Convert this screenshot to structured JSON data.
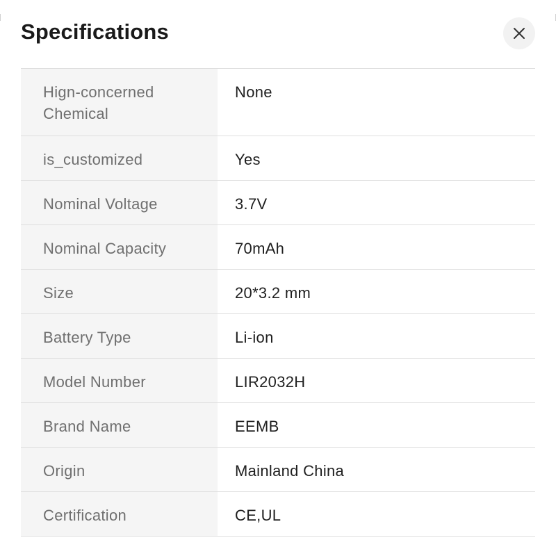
{
  "dialog": {
    "title": "Specifications"
  },
  "close_icon": "close-icon",
  "specs": [
    {
      "label": "Hign-concerned Chemical",
      "value": "None"
    },
    {
      "label": "is_customized",
      "value": "Yes"
    },
    {
      "label": "Nominal Voltage",
      "value": "3.7V"
    },
    {
      "label": "Nominal Capacity",
      "value": "70mAh"
    },
    {
      "label": "Size",
      "value": "20*3.2 mm"
    },
    {
      "label": "Battery Type",
      "value": "Li-ion"
    },
    {
      "label": "Model Number",
      "value": "LIR2032H"
    },
    {
      "label": "Brand Name",
      "value": "EEMB"
    },
    {
      "label": "Origin",
      "value": "Mainland China"
    },
    {
      "label": "Certification",
      "value": "CE,UL"
    }
  ],
  "colors": {
    "label_background": "#f5f5f5",
    "label_text": "#6f6f6f",
    "value_text": "#1f1f1f",
    "divider": "#dedede",
    "close_button_background": "#f2f2f2"
  }
}
